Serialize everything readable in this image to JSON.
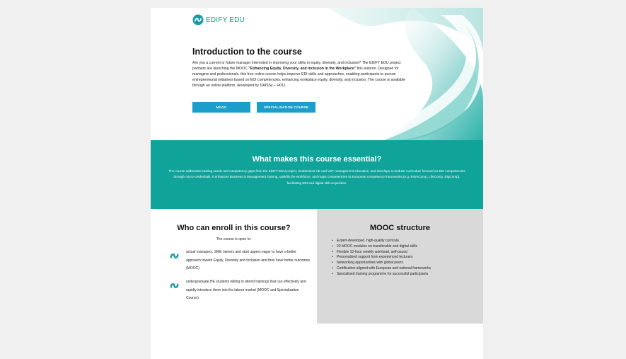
{
  "brand": {
    "logo_text": "EDIFY EDU",
    "accent": "#1a9aa6",
    "teal": "#0fa39a",
    "button_blue": "#1b9ec9"
  },
  "hero": {
    "title": "Introduction to the course",
    "text_part1": "Are you a current or future manager interested in improving your skills in equity, diversity, and inclusion? The EDIFY EDU project partners are launching the MOOC ",
    "text_bold": "\"Enhancing Equity, Diversity, and Inclusion in the Workplace\"",
    "text_part2": " this autumn. Designed for managers and professionals, this free online course helps improve EDI skills and approaches, enabling participants to pursue entrepreneurial initiatives based on EDI competencies, enhancing workplace equity, diversity, and inclusion. The course is available through an online platform, developed by DAISSy – HOU.",
    "buttons": [
      "MOOC",
      "SPECIALISATION COURSE"
    ]
  },
  "essential": {
    "title": "What makes this course essential?",
    "text": "The course addresses training needs and competency gaps from the EDIFY-EDU project, modernizes HE and VET management education, and develops a modular curriculum focused on EDI competencies through micro-credentials. It enhances Business & Management training, upskills the workforce, and maps competencies to European competence frameworks (e.g. EntreComp, LifeComp, DigComp), facilitating EDI and digital skill acquisition."
  },
  "enroll": {
    "title": "Who can enroll in this course?",
    "subtitle": "The course is open to:",
    "items": [
      "actual managers, SME owners and start uppers eager to have a better approach toward Equity, Diversity and Inclusion and thus have better outcomes (MOOC).",
      "undergraduate HE students willing to attend trainings that can effectively and rapidly introduce them into the labour market (MOOC and Specialization Course)."
    ]
  },
  "structure": {
    "title": "MOOC structure",
    "items": [
      "Expert-developed, high-quality curricula",
      "20 MOOC modules on transferable and digital skills",
      "Flexible 10-hour weekly workload, self-paced",
      "Personalized support from experienced lecturers",
      "Networking opportunities with global peers",
      "Certification aligned with European and national frameworks",
      "Specialised training programme for successful participants"
    ]
  }
}
